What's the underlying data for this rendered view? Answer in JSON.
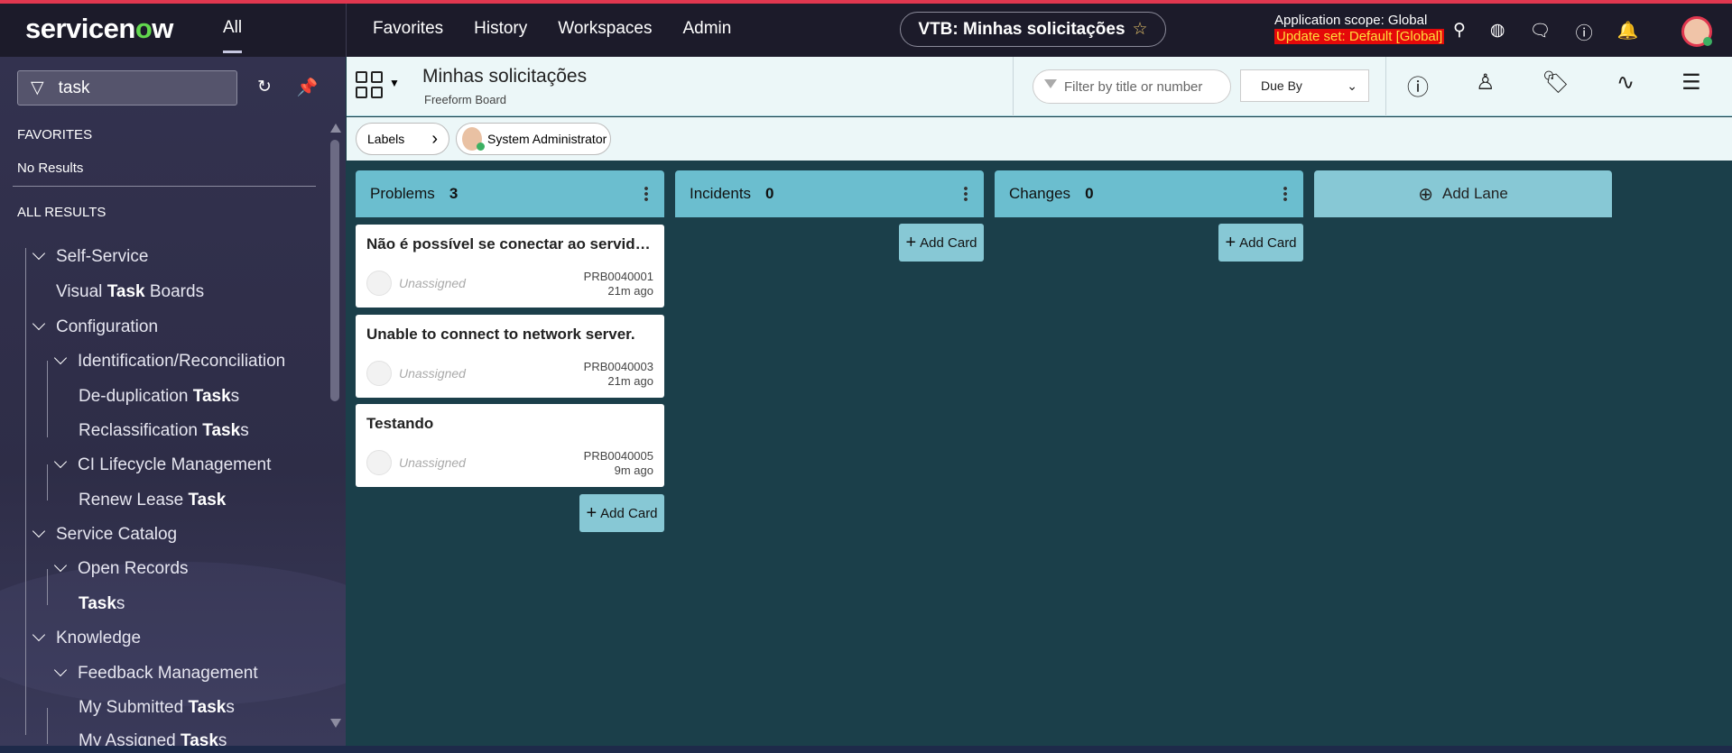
{
  "topbar": {
    "logo": "servicenow",
    "all": "All",
    "nav": [
      "Favorites",
      "History",
      "Workspaces",
      "Admin"
    ],
    "page_pill": "VTB: Minhas solicitações",
    "scope": "Application scope: Global",
    "update_set": "Update set: Default [Global]",
    "accent": "#e0374f"
  },
  "sidebar": {
    "search_value": "task",
    "favorites_heading": "FAVORITES",
    "no_results": "No Results",
    "all_results_heading": "ALL RESULTS",
    "items": [
      {
        "pre": "Self-Service",
        "bold": "",
        "post": ""
      },
      {
        "pre": "Visual ",
        "bold": "Task",
        "post": " Boards"
      },
      {
        "pre": "Configuration",
        "bold": "",
        "post": ""
      },
      {
        "pre": "Identification/Reconciliation",
        "bold": "",
        "post": ""
      },
      {
        "pre": "De-duplication ",
        "bold": "Task",
        "post": "s"
      },
      {
        "pre": "Reclassification ",
        "bold": "Task",
        "post": "s"
      },
      {
        "pre": "CI Lifecycle Management",
        "bold": "",
        "post": ""
      },
      {
        "pre": "Renew Lease ",
        "bold": "Task",
        "post": ""
      },
      {
        "pre": "Service Catalog",
        "bold": "",
        "post": ""
      },
      {
        "pre": "Open Records",
        "bold": "",
        "post": ""
      },
      {
        "pre": "",
        "bold": "Task",
        "post": "s"
      },
      {
        "pre": "Knowledge",
        "bold": "",
        "post": ""
      },
      {
        "pre": "Feedback Management",
        "bold": "",
        "post": ""
      },
      {
        "pre": "My Submitted ",
        "bold": "Task",
        "post": "s"
      },
      {
        "pre": "My Assigned ",
        "bold": "Task",
        "post": "s"
      }
    ]
  },
  "board": {
    "title": "Minhas solicitações",
    "subtitle": "Freeform Board",
    "filter_placeholder": "Filter by title or number",
    "sort_value": "Due By",
    "labels_chip": "Labels",
    "member_chip": "System Administrator",
    "lanes": [
      {
        "name": "Problems",
        "count": "3"
      },
      {
        "name": "Incidents",
        "count": "0"
      },
      {
        "name": "Changes",
        "count": "0"
      }
    ],
    "add_lane": "Add Lane",
    "add_card": "Add Card",
    "cards": [
      {
        "title": "Não é possível se conectar ao servidor de rede.",
        "assignee": "Unassigned",
        "number": "PRB0040001",
        "age": "21m ago"
      },
      {
        "title": "Unable to connect to network server.",
        "assignee": "Unassigned",
        "number": "PRB0040003",
        "age": "21m ago"
      },
      {
        "title": "Testando",
        "assignee": "Unassigned",
        "number": "PRB0040005",
        "age": "9m ago"
      }
    ]
  }
}
